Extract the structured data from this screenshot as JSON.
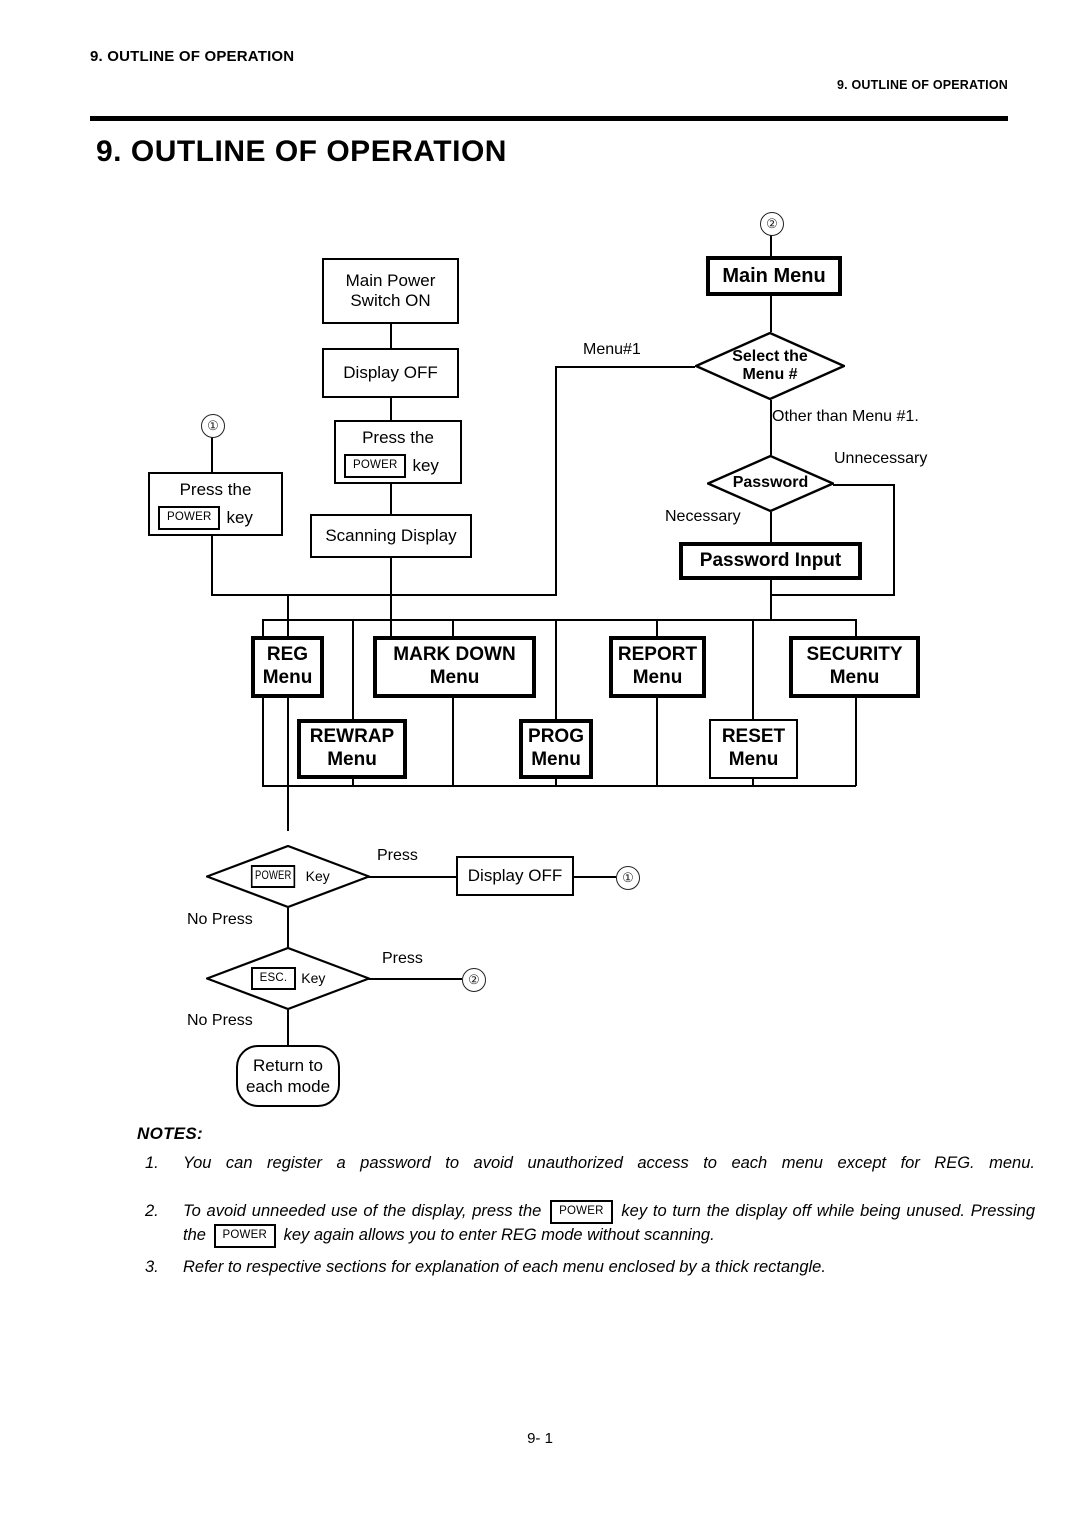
{
  "header": {
    "running_head_left": "9. OUTLINE OF OPERATION",
    "running_head_right": "9. OUTLINE OF OPERATION",
    "title": "9. OUTLINE OF OPERATION"
  },
  "footer": {
    "page_number": "9- 1"
  },
  "flowchart": {
    "connectors": {
      "one": "①",
      "two": "②"
    },
    "boxes": {
      "main_power": "Main Power\nSwitch ON",
      "main_power_l1": "Main Power",
      "main_power_l2": "Switch ON",
      "display_off_top": "Display OFF",
      "press_power_center_l1": "Press the",
      "press_power_center_key": "POWER",
      "press_power_center_l2": "key",
      "scanning_display": "Scanning Display",
      "press_power_left_l1": "Press the",
      "press_power_left_key": "POWER",
      "press_power_left_l2": "key",
      "main_menu": "Main Menu",
      "password_input": "Password Input",
      "display_off_bottom": "Display OFF",
      "return_each_mode_l1": "Return to",
      "return_each_mode_l2": "each mode"
    },
    "diamonds": {
      "select_menu_l1": "Select the",
      "select_menu_l2": "Menu #",
      "password": "Password",
      "power_key_key": "POWER",
      "power_key_word": "Key",
      "esc_key_key": "ESC.",
      "esc_key_word": "Key"
    },
    "edge_labels": {
      "menu_1": "Menu#1",
      "other_than_menu_1": "Other than Menu #1.",
      "unnecessary": "Unnecessary",
      "necessary": "Necessary",
      "press_1": "Press",
      "no_press_1": "No Press",
      "press_2": "Press",
      "no_press_2": "No Press"
    },
    "menus": [
      {
        "name": "REG",
        "sub": "Menu",
        "thick": true
      },
      {
        "name": "MARK DOWN",
        "sub": "Menu",
        "thick": true
      },
      {
        "name": "REPORT",
        "sub": "Menu",
        "thick": true
      },
      {
        "name": "SECURITY",
        "sub": "Menu",
        "thick": true
      },
      {
        "name": "REWRAP",
        "sub": "Menu",
        "thick": true
      },
      {
        "name": "PROG",
        "sub": "Menu",
        "thick": true
      },
      {
        "name": "RESET",
        "sub": "Menu",
        "thick": false
      }
    ]
  },
  "notes": {
    "title": "NOTES:",
    "items": [
      {
        "num": "1.",
        "text": "You can register a password to avoid unauthorized access to each menu except for REG. menu."
      },
      {
        "num": "2.",
        "part1": "To avoid unneeded use of the display, press the",
        "key1": "POWER",
        "part2": "key to turn the display off while being unused.   Pressing the",
        "key2": "POWER",
        "part3": "key again allows you to enter REG mode without scanning."
      },
      {
        "num": "3.",
        "text": "Refer to respective sections for explanation of each menu enclosed by a thick rectangle."
      }
    ]
  }
}
